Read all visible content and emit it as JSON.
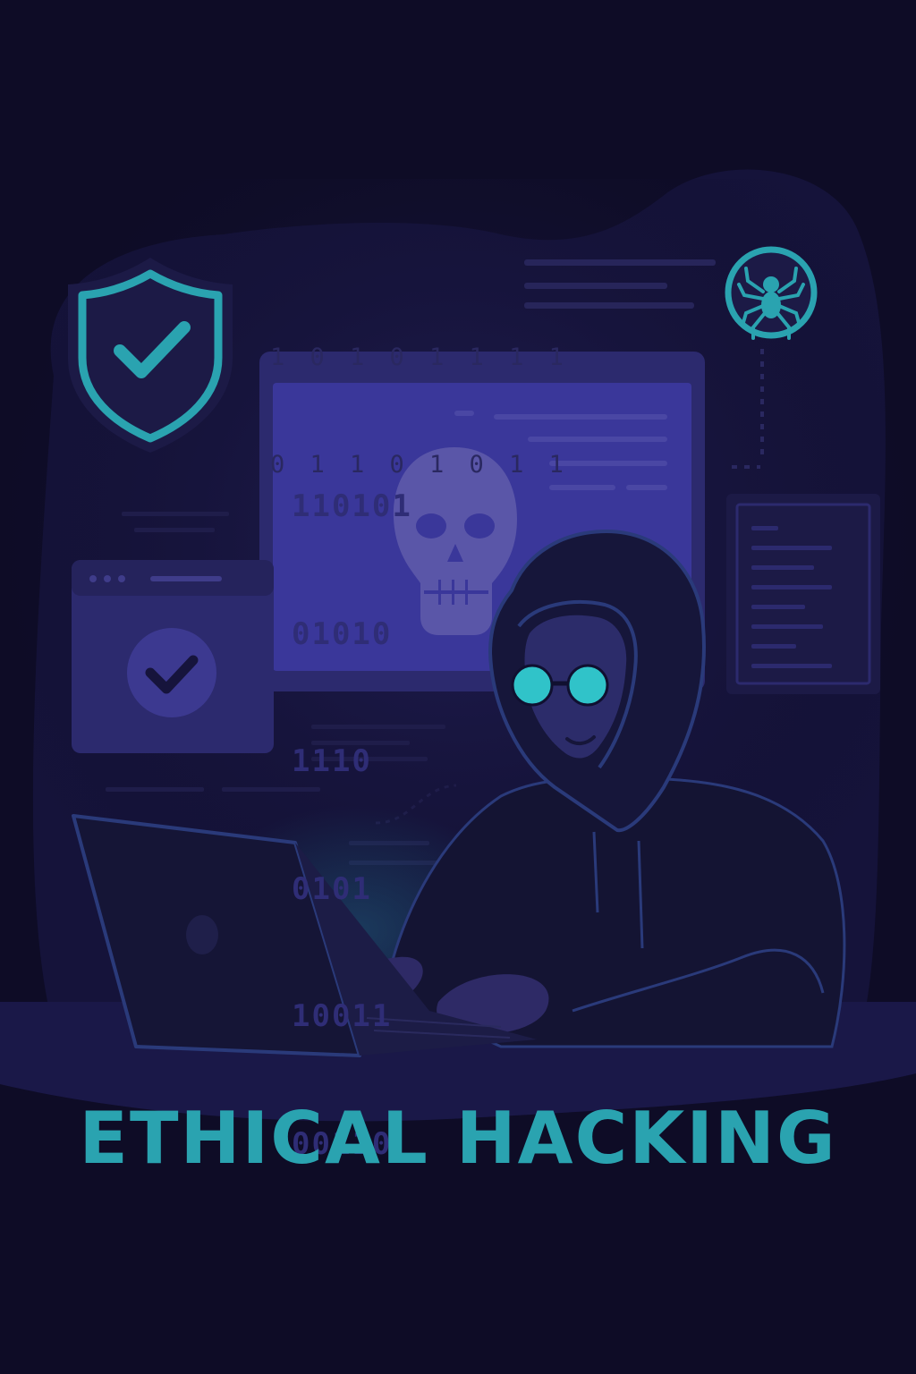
{
  "title": "ETHICAL HACKING",
  "binary_top": [
    "1 0 1 0 1 1 1 1",
    "0 1 1 0 1 0 1 1"
  ],
  "binary_screen": [
    "110101",
    "01010",
    "1110",
    "0101",
    "10011",
    "00110"
  ],
  "colors": {
    "background": "#0e0c26",
    "accent": "#2aa3b0",
    "panel": "#2c2a6e",
    "screen": "#3a379a",
    "skull": "#5a56a8",
    "hoodie": "#141433"
  },
  "icons": [
    "shield-check-icon",
    "spider-icon",
    "check-circle-icon",
    "skull-icon",
    "laptop-icon"
  ]
}
